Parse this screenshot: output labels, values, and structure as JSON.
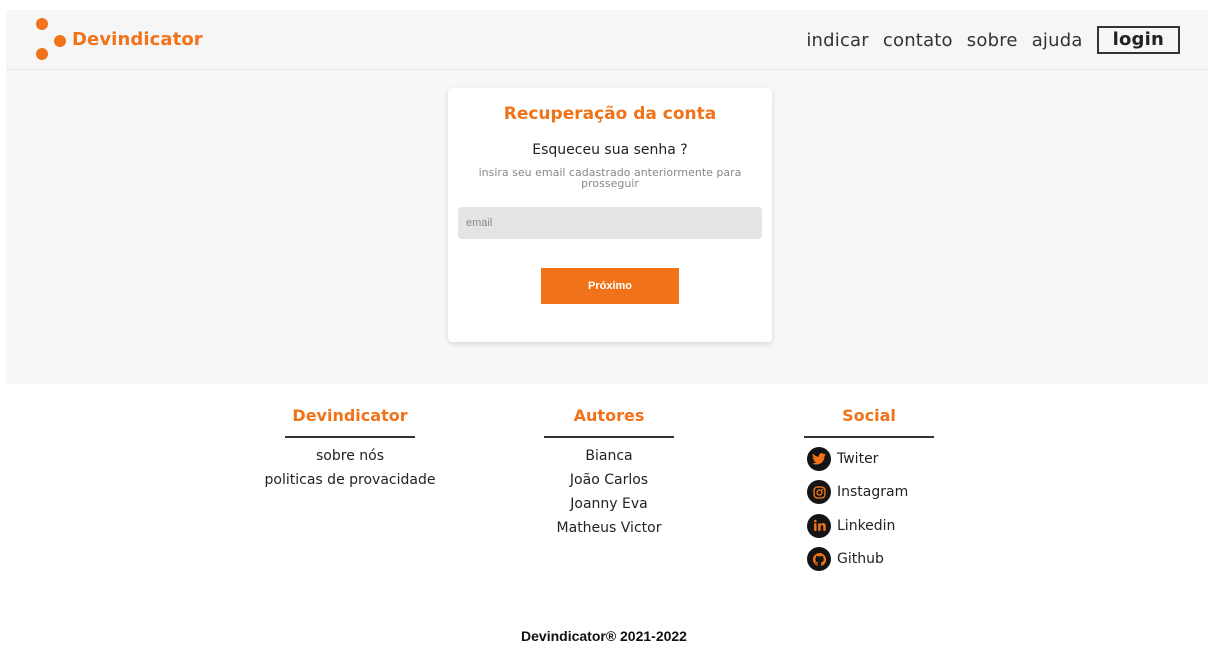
{
  "header": {
    "brand": "Devindicator",
    "nav": {
      "indicar": "indicar",
      "contato": "contato",
      "sobre": "sobre",
      "ajuda": "ajuda",
      "login": "login"
    }
  },
  "card": {
    "title": "Recuperação da conta",
    "question": "Esqueceu sua senha ?",
    "hint": "insira seu email cadastrado anteriormente para prosseguir",
    "email_placeholder": "email",
    "next_label": "Próximo"
  },
  "footer": {
    "brand": {
      "heading": "Devindicator",
      "links": [
        "sobre nós",
        "politicas de provacidade"
      ]
    },
    "authors": {
      "heading": "Autores",
      "names": [
        "Bianca",
        "João Carlos",
        "Joanny Eva",
        "Matheus Victor"
      ]
    },
    "social": {
      "heading": "Social",
      "items": [
        {
          "label": "Twiter",
          "icon": "twitter-icon"
        },
        {
          "label": "Instagram",
          "icon": "instagram-icon"
        },
        {
          "label": "Linkedin",
          "icon": "linkedin-icon"
        },
        {
          "label": "Github",
          "icon": "github-icon"
        }
      ]
    },
    "copyright": "Devindicator® 2021-2022"
  },
  "colors": {
    "accent": "#f07319",
    "header_bg": "#f6f6f6",
    "main_bg": "#f7f7f7",
    "input_bg": "#e4e4e4"
  }
}
